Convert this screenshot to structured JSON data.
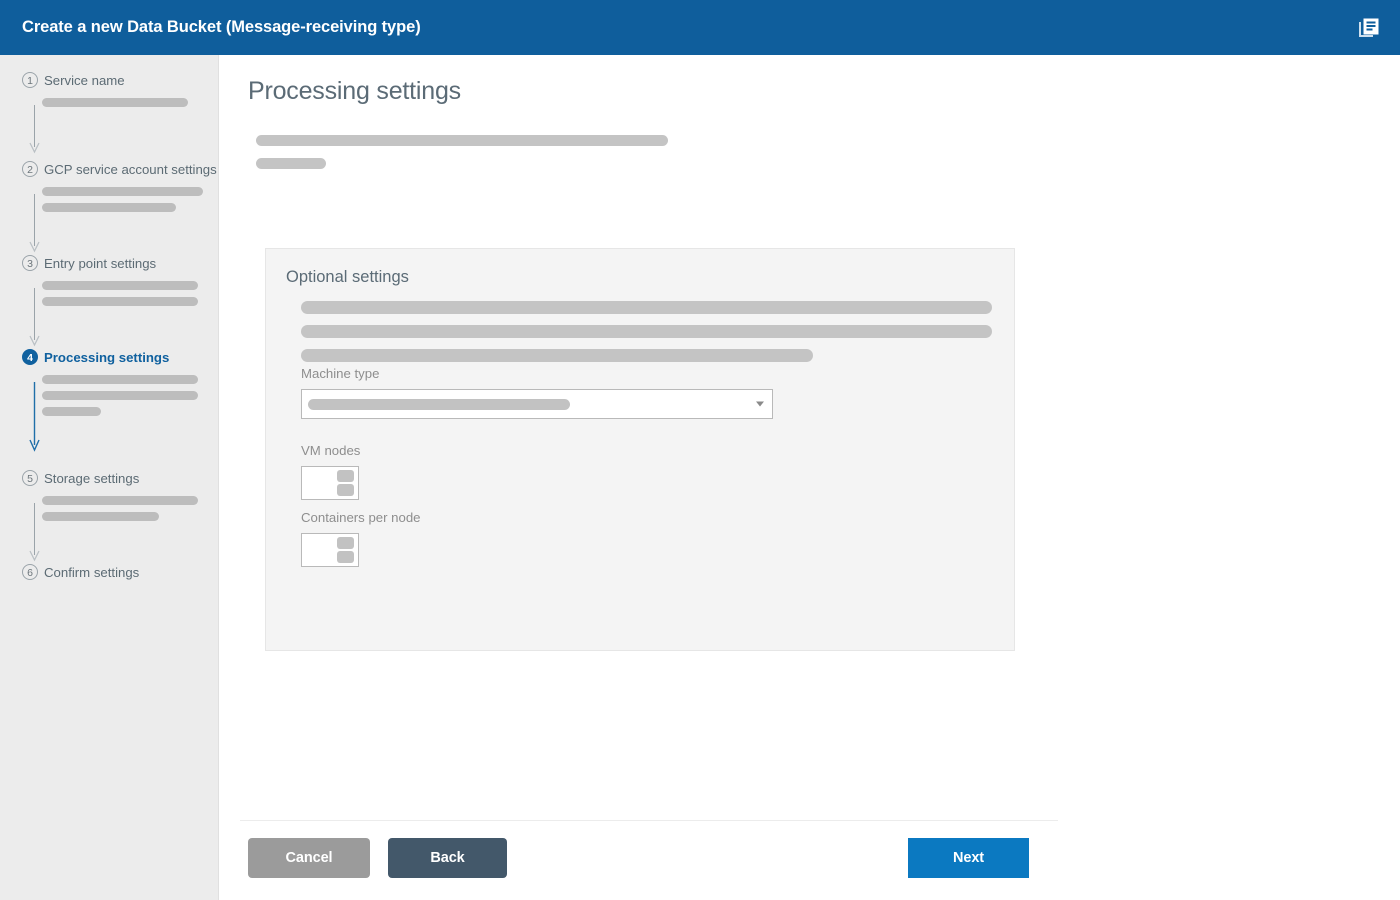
{
  "titlebar": {
    "title": "Create a new Data Bucket (Message-receiving type)",
    "doc_icon": "documents-icon",
    "background": "#0f5e9c"
  },
  "sidebar": {
    "background": "#ececec",
    "active_step": 4,
    "steps": [
      {
        "number": "1",
        "label": "Service name",
        "active": false,
        "placeholder_bars": [
          146
        ]
      },
      {
        "number": "2",
        "label": "GCP service account settings",
        "active": false,
        "placeholder_bars": [
          161,
          134
        ]
      },
      {
        "number": "3",
        "label": "Entry point settings",
        "active": false,
        "placeholder_bars": [
          156,
          156
        ]
      },
      {
        "number": "4",
        "label": "Processing settings",
        "active": true,
        "placeholder_bars": [
          156,
          156,
          59
        ]
      },
      {
        "number": "5",
        "label": "Storage settings",
        "active": false,
        "placeholder_bars": [
          156,
          117
        ]
      },
      {
        "number": "6",
        "label": "Confirm settings",
        "active": false,
        "placeholder_bars": []
      }
    ]
  },
  "main": {
    "page_title": "Processing settings",
    "intro_bars": [
      412,
      70
    ],
    "panel": {
      "title": "Optional settings",
      "description_bars": [
        691,
        691,
        512
      ],
      "fields": {
        "machine_type": {
          "label": "Machine type",
          "value": "",
          "placeholder_bar": 262,
          "caret_icon": "chevron-down-icon"
        },
        "vm_nodes": {
          "label": "VM nodes",
          "value": "",
          "increment_icon": "stepper-up-icon",
          "decrement_icon": "stepper-down-icon"
        },
        "containers_per_node": {
          "label": "Containers per node",
          "value": "",
          "increment_icon": "stepper-up-icon",
          "decrement_icon": "stepper-down-icon"
        }
      }
    }
  },
  "footer": {
    "cancel_label": "Cancel",
    "back_label": "Back",
    "next_label": "Next",
    "cancel_color": "#9b9b9b",
    "back_color": "#43586a",
    "next_color": "#0b79c1"
  }
}
